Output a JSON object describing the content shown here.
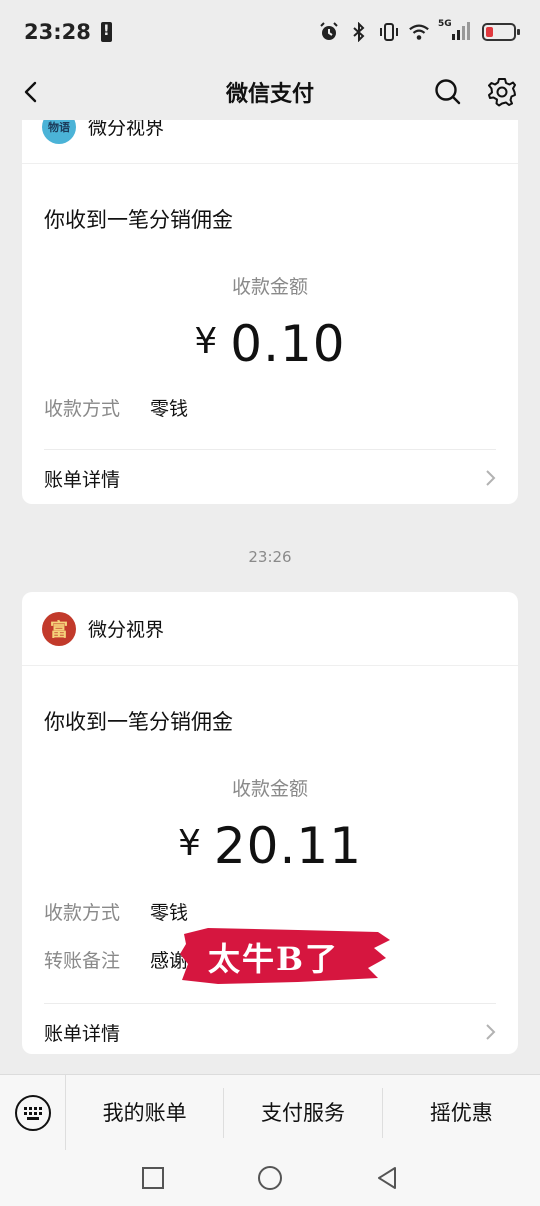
{
  "status_bar": {
    "time": "23:28",
    "network": "5G"
  },
  "nav": {
    "title": "微信支付"
  },
  "cards": [
    {
      "merchant": "微分视界",
      "avatar_text": "物语",
      "title": "你收到一笔分销佣金",
      "amount_label": "收款金额",
      "currency": "¥",
      "amount": "0.10",
      "fields": [
        {
          "key": "收款方式",
          "value": "零钱"
        }
      ],
      "footer": "账单详情"
    },
    {
      "merchant": "微分视界",
      "avatar_text": "富",
      "title": "你收到一笔分销佣金",
      "amount_label": "收款金额",
      "currency": "¥",
      "amount": "20.11",
      "fields": [
        {
          "key": "收款方式",
          "value": "零钱"
        },
        {
          "key": "转账备注",
          "value": "感谢"
        }
      ],
      "footer": "账单详情"
    }
  ],
  "timestamp": "23:26",
  "sticker": {
    "text": "太牛B了",
    "color": "#d6163f"
  },
  "bottom_menu": {
    "items": [
      "我的账单",
      "支付服务",
      "摇优惠"
    ]
  },
  "colors": {
    "background": "#ededed",
    "card": "#ffffff",
    "muted_text": "#8a8a8a"
  }
}
